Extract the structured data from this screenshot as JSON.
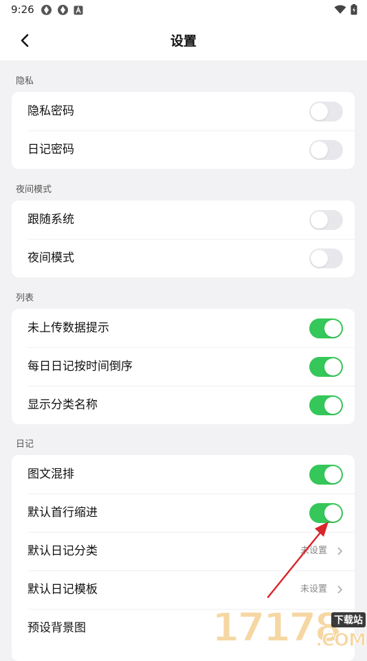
{
  "status_bar": {
    "time": "9:26"
  },
  "header": {
    "title": "设置"
  },
  "sections": [
    {
      "label": "隐私",
      "items": [
        {
          "label": "隐私密码",
          "type": "toggle",
          "on": false
        },
        {
          "label": "日记密码",
          "type": "toggle",
          "on": false
        }
      ]
    },
    {
      "label": "夜间模式",
      "items": [
        {
          "label": "跟随系统",
          "type": "toggle",
          "on": false
        },
        {
          "label": "夜间模式",
          "type": "toggle",
          "on": false
        }
      ]
    },
    {
      "label": "列表",
      "items": [
        {
          "label": "未上传数据提示",
          "type": "toggle",
          "on": true
        },
        {
          "label": "每日日记按时间倒序",
          "type": "toggle",
          "on": true
        },
        {
          "label": "显示分类名称",
          "type": "toggle",
          "on": true
        }
      ]
    },
    {
      "label": "日记",
      "items": [
        {
          "label": "图文混排",
          "type": "toggle",
          "on": true
        },
        {
          "label": "默认首行缩进",
          "type": "toggle",
          "on": true
        },
        {
          "label": "默认日记分类",
          "type": "select",
          "value": "未设置"
        },
        {
          "label": "默认日记模板",
          "type": "select",
          "value": "未设置"
        },
        {
          "label": "预设背景图",
          "type": "select",
          "value": ""
        }
      ]
    }
  ],
  "watermark": {
    "digits": "17178",
    "tag": "下载站",
    "suffix": ".COM"
  },
  "colors": {
    "toggle_on": "#35c759",
    "toggle_off": "#e8e8ec",
    "annotation_arrow": "#d9262b"
  }
}
